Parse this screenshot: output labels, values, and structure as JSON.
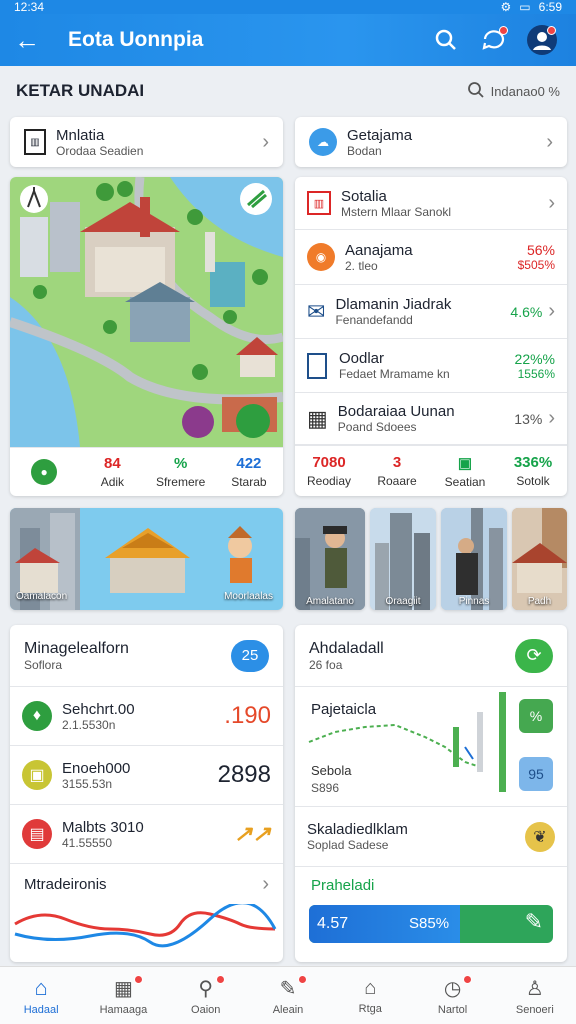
{
  "status": {
    "time": "12:34",
    "clock": "6:59"
  },
  "appbar": {
    "title": "Eota Uonnpia"
  },
  "section": {
    "title": "KETAR UNADAI",
    "filter": "Indanao0 %"
  },
  "top_cards": [
    {
      "title": "Mnlatia",
      "subtitle": "Orodaa Seadien"
    },
    {
      "title": "Getajama",
      "subtitle": "Bodan"
    }
  ],
  "map_stats": [
    {
      "value": "84",
      "label": "Adik"
    },
    {
      "value": "%",
      "label": "Sfremere"
    },
    {
      "value": "422",
      "label": "Starab"
    }
  ],
  "list_items": [
    {
      "title": "Sotalia",
      "subtitle": "Mstern Mlaar Sanokl",
      "v1": "",
      "v2": ""
    },
    {
      "title": "Aanajama",
      "subtitle": "2. tleo",
      "v1": "56%",
      "v2": "$505%"
    },
    {
      "title": "Dlamanin Jiadrak",
      "subtitle": "Fenandefandd",
      "v1": "4.6%",
      "v2": ""
    },
    {
      "title": "Oodlar",
      "subtitle": "Fedaet Mramame kn",
      "v1": "22%%",
      "v2": "1556%"
    },
    {
      "title": "Bodaraiaa Uunan",
      "subtitle": "Poand Sdoees",
      "v1": "13%",
      "v2": ""
    }
  ],
  "list_stats": [
    {
      "value": "7080",
      "label": "Reodiay"
    },
    {
      "value": "3",
      "label": "Roaare"
    },
    {
      "value": "",
      "label": "Seatian"
    },
    {
      "value": "336%",
      "label": "Sotolk"
    }
  ],
  "banner": {
    "left": "Oamalacon",
    "right": "Moorlaalas"
  },
  "photos": [
    "Amalatano",
    "Oraagiit",
    "Pinnas",
    "Padh"
  ],
  "left_panel": {
    "title": "Minagelealforn",
    "subtitle": "Soflora",
    "badge": "25",
    "rows": [
      {
        "title": "Sehchrt.00",
        "subtitle": "2.1.5530n",
        "value": ".190"
      },
      {
        "title": "Enoeh000",
        "subtitle": "3155.53n",
        "value": "2898"
      },
      {
        "title": "Malbts 3010",
        "subtitle": "41.55550",
        "value": ""
      }
    ],
    "footer": "Mtradeironis"
  },
  "right_panel": {
    "title": "Ahdaladall",
    "subtitle": "26 foa",
    "chart_title": "Pajetaicla",
    "chart_sub1": "Sebola",
    "chart_sub2": "S896",
    "chip1": "%",
    "chip2": "95",
    "row_title": "Skaladiedlklam",
    "row_sub": "Soplad Sadese",
    "progress_title": "Praheladi",
    "progress_left": "4.57",
    "progress_right": "S85%"
  },
  "nav": [
    "Hadaal",
    "Hamaaga",
    "Oaion",
    "Aleain",
    "Rtga",
    "Nartol",
    "Senoeri"
  ],
  "colors": {
    "primary": "#1e88e5",
    "green": "#16a34a",
    "red": "#dc2626"
  }
}
